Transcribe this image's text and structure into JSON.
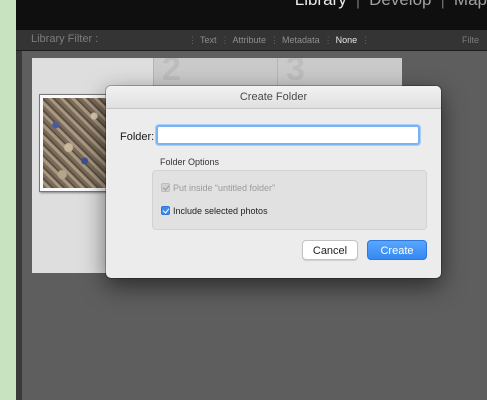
{
  "module_nav": {
    "items": [
      {
        "label": "Library",
        "active": true
      },
      {
        "label": "Develop",
        "active": false
      },
      {
        "label": "Map",
        "active": false
      }
    ],
    "separator": "|"
  },
  "filter_bar": {
    "label": "Library Filter :",
    "options": [
      "Text",
      "Attribute",
      "Metadata",
      "None"
    ],
    "active_option": "None",
    "right_label": "Filte"
  },
  "grid": {
    "cells": [
      {
        "number": ""
      },
      {
        "number": "2"
      },
      {
        "number": "3"
      }
    ]
  },
  "dialog": {
    "title": "Create Folder",
    "folder_label": "Folder:",
    "folder_value": "",
    "options_heading": "Folder Options",
    "option_put_inside": {
      "label": "Put inside “untitled folder”",
      "checked": true,
      "enabled": false
    },
    "option_include_photos": {
      "label": "Include selected photos",
      "checked": true,
      "enabled": true
    },
    "cancel_label": "Cancel",
    "create_label": "Create"
  },
  "colors": {
    "accent": "#3c8cf0",
    "frame_background": "#c8e3c0",
    "grid_background": "#5e5e5e"
  }
}
